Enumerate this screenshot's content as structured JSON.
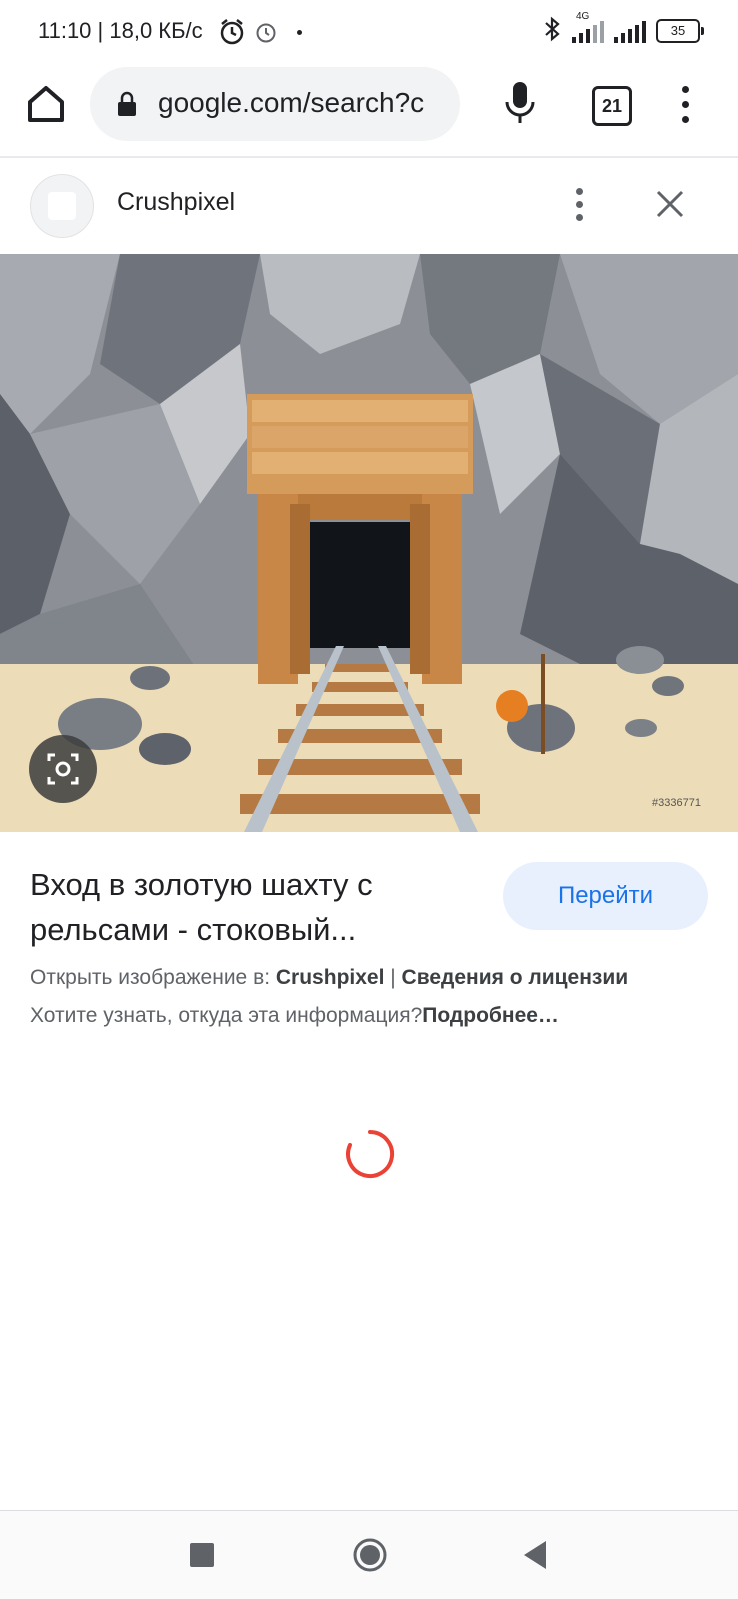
{
  "status_bar": {
    "time": "11:10 | 18,0 КБ/с",
    "network": "4G",
    "battery": "35"
  },
  "browser": {
    "url": "google.com/search?c",
    "tab_count": "21"
  },
  "source": {
    "name": "Crushpixel"
  },
  "image": {
    "watermark": "#3336771"
  },
  "result": {
    "title": "Вход в золотую шахту с рельсами - стоковый...",
    "go_button": "Перейти",
    "open_prefix": "Открыть изображение в: ",
    "open_source": "Crushpixel",
    "separator": " | ",
    "license_link": "Сведения о лицензии",
    "why_text": "Хотите узнать, откуда эта информация?",
    "more_link": "Подробнее…"
  },
  "colors": {
    "accent": "#1a73e8",
    "spinner": "#ea4335",
    "button_bg": "#e8f0fe"
  }
}
